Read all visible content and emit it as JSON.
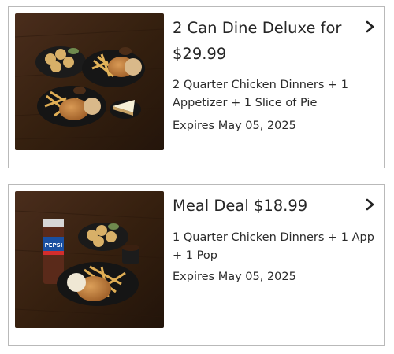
{
  "offers": [
    {
      "title": "2 Can Dine Deluxe for $29.99",
      "description": "2 Quarter Chicken Dinners + 1 Appetizer + 1 Slice of Pie",
      "expires": "Expires May 05, 2025",
      "image_icon": "meal-photo-icon",
      "chevron_icon": "chevron-right-icon"
    },
    {
      "title": "Meal Deal $18.99",
      "description": "1 Quarter Chicken Dinners + 1 App + 1 Pop",
      "expires": "Expires May 05, 2025",
      "image_icon": "meal-photo-icon",
      "chevron_icon": "chevron-right-icon",
      "cup_text": "PEPSI"
    }
  ],
  "colors": {
    "border": "#b9b9b9",
    "text": "#2b2b2b",
    "wood": "#3b2417",
    "pepsi_blue": "#1a4fa0",
    "pepsi_red": "#d32d2d"
  }
}
